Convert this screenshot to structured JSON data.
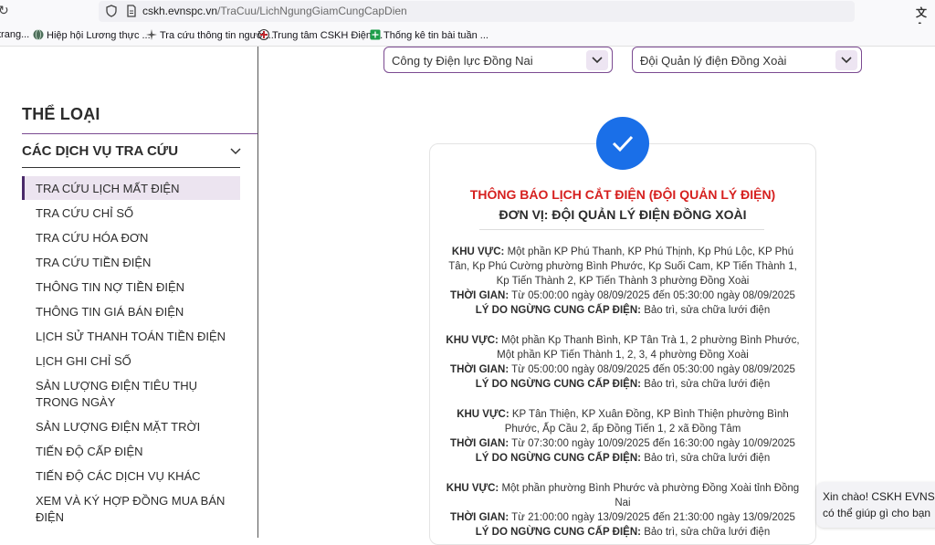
{
  "browser": {
    "url_host": "cskh.evnspc.vn",
    "url_path": "/TraCuu/LichNgungGiamCungCapDien",
    "bookmarks": [
      {
        "label": "trang..."
      },
      {
        "label": "Hiệp hội Lương thực ..."
      },
      {
        "label": "Tra cứu thông tin người..."
      },
      {
        "label": "Trung tâm CSKH Điện ..."
      },
      {
        "label": "Thống kê tin bài tuần ..."
      }
    ]
  },
  "sidebar": {
    "title": "THỂ LOẠI",
    "group_label": "CÁC DỊCH VỤ TRA CỨU",
    "items": [
      {
        "label": "TRA CỨU LỊCH MẤT ĐIỆN"
      },
      {
        "label": "TRA CỨU CHỈ SỐ"
      },
      {
        "label": "TRA CỨU HÓA ĐƠN"
      },
      {
        "label": "TRA CỨU TIỀN ĐIỆN"
      },
      {
        "label": "THÔNG TIN NỢ TIỀN ĐIỆN"
      },
      {
        "label": "THÔNG TIN GIÁ BÁN ĐIỆN"
      },
      {
        "label": "LỊCH SỬ THANH TOÁN TIỀN ĐIỆN"
      },
      {
        "label": "LỊCH GHI CHỈ SỐ"
      },
      {
        "label": "SẢN LƯỢNG ĐIỆN TIÊU THỤ TRONG NGÀY"
      },
      {
        "label": "SẢN LƯỢNG ĐIỆN MẶT TRỜI"
      },
      {
        "label": "TIẾN ĐỘ CẤP ĐIỆN"
      },
      {
        "label": "TIẾN ĐỘ CÁC DỊCH VỤ KHÁC"
      },
      {
        "label": "XEM VÀ KÝ HỢP ĐỒNG MUA BÁN ĐIỆN"
      }
    ]
  },
  "filters": {
    "company": "Công ty Điện lực Đồng Nai",
    "team": "Đội Quản lý điện Đồng Xoài"
  },
  "notice": {
    "title": "THÔNG BÁO LỊCH CẮT ĐIỆN (ĐỘI QUẢN LÝ ĐIỆN)",
    "unit": "ĐƠN VỊ: ĐỘI QUẢN LÝ ĐIỆN ĐỒNG XOÀI",
    "area_label": "KHU VỰC:",
    "time_label": "THỜI GIAN:",
    "reason_label": "LÝ DO NGỪNG CUNG CẤP ĐIỆN:",
    "entries": [
      {
        "area": "Một phần KP Phú Thanh, KP Phú Thịnh, Kp Phú Lộc, KP Phú Tân, Kp Phú Cường phường Bình Phước, Kp Suối Cam, KP Tiến Thành 1, Kp Tiến Thành 2, KP Tiến Thành 3 phường Đồng Xoài",
        "time": "Từ 05:00:00 ngày 08/09/2025 đến 05:30:00 ngày 08/09/2025",
        "reason": "Bảo trì, sửa chữa lưới điện"
      },
      {
        "area": "Một phần Kp Thanh Bình, KP Tân Trà 1, 2 phường Bình Phước, Một phần KP Tiến Thành 1, 2, 3, 4 phường Đồng Xoài",
        "time": "Từ 05:00:00 ngày 08/09/2025 đến 05:30:00 ngày 08/09/2025",
        "reason": "Bảo trì, sửa chữa lưới điện"
      },
      {
        "area": "KP Tân Thiện, KP Xuân Đồng, KP Bình Thiện phường Bình Phước, Ấp Cầu 2, ấp Đồng Tiến 1, 2 xã Đồng Tâm",
        "time": "Từ 07:30:00 ngày 10/09/2025 đến 16:30:00 ngày 10/09/2025",
        "reason": "Bảo trì, sửa chữa lưới điện"
      },
      {
        "area": "Một phần phường Bình Phước và phường Đồng Xoài tỉnh Đồng Nai",
        "time": "Từ 21:00:00 ngày 13/09/2025 đến 21:30:00 ngày 13/09/2025",
        "reason": "Bảo trì, sửa chữa lưới điện"
      }
    ]
  },
  "chat": {
    "line1": "Xin chào! CSKH EVNS",
    "line2": "có thể giúp gì cho bạn"
  },
  "colors": {
    "accent": "#7b4a91",
    "alert_red": "#d6201f",
    "check_blue": "#1a6fe8"
  }
}
